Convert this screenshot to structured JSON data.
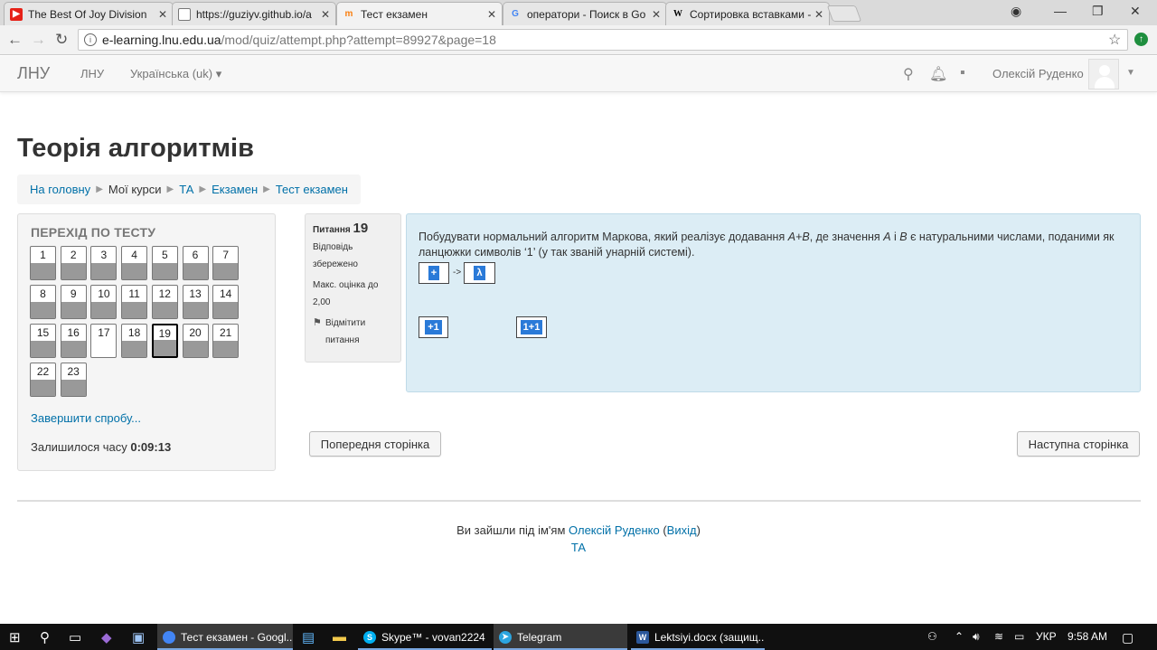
{
  "browser": {
    "tabs": [
      {
        "title": "The Best Of Joy Division",
        "icon": "youtube-icon",
        "color": "#e62117"
      },
      {
        "title": "https://guziyv.github.io/a",
        "icon": "page-icon",
        "color": "#777777"
      },
      {
        "title": "Тест екзамен",
        "icon": "moodle-icon",
        "color": "#f98012"
      },
      {
        "title": "оператори - Поиск в Go",
        "icon": "google-icon",
        "color": "#4285f4"
      },
      {
        "title": "Сортировка вставками -",
        "icon": "wikipedia-icon",
        "color": "#000000"
      }
    ],
    "url_host": "e-learning.lnu.edu.ua",
    "url_path": "/mod/quiz/attempt.php?attempt=89927&page=18"
  },
  "navbar": {
    "brand": "ЛНУ",
    "link_lnu": "ЛНУ",
    "language": "Українська (uk)",
    "user_name": "Олексій Руденко"
  },
  "page": {
    "title": "Теорія алгоритмів",
    "breadcrumb": [
      "На головну",
      "Мої курси",
      "ТА",
      "Екзамен",
      "Тест екзамен"
    ]
  },
  "quiz_nav": {
    "title": "ПЕРЕХІД ПО ТЕСТУ",
    "questions": [
      {
        "n": "1",
        "answered": true
      },
      {
        "n": "2",
        "answered": true
      },
      {
        "n": "3",
        "answered": true
      },
      {
        "n": "4",
        "answered": true
      },
      {
        "n": "5",
        "answered": true
      },
      {
        "n": "6",
        "answered": true
      },
      {
        "n": "7",
        "answered": true
      },
      {
        "n": "8",
        "answered": true
      },
      {
        "n": "9",
        "answered": true
      },
      {
        "n": "10",
        "answered": true
      },
      {
        "n": "11",
        "answered": true
      },
      {
        "n": "12",
        "answered": true
      },
      {
        "n": "13",
        "answered": true
      },
      {
        "n": "14",
        "answered": true
      },
      {
        "n": "15",
        "answered": true
      },
      {
        "n": "16",
        "answered": true
      },
      {
        "n": "17",
        "answered": false
      },
      {
        "n": "18",
        "answered": true
      },
      {
        "n": "19",
        "answered": true,
        "current": true
      },
      {
        "n": "20",
        "answered": true
      },
      {
        "n": "21",
        "answered": true
      },
      {
        "n": "22",
        "answered": true
      },
      {
        "n": "23",
        "answered": true
      }
    ],
    "finish_link": "Завершити спробу...",
    "time_left_label": "Залишилося часу",
    "time_left": "0:09:13"
  },
  "question": {
    "label": "Питання",
    "number": "19",
    "state": "Відповідь збережено",
    "max_mark": "Макс. оцінка до 2,00",
    "flag_label": "Відмітити питання",
    "text_part1": "Побудувати нормальний алгоритм Маркова, який реалізує додавання ",
    "text_expr": "A+B",
    "text_part2": ", де значення ",
    "text_a": "A",
    "text_and": " і ",
    "text_b": "B",
    "text_part3": " є натуральними числами, поданими як ланцюжки символів ‘1’ (у так званій унарній системі).",
    "rule_left": "+",
    "rule_arrow": "->",
    "rule_right": "λ",
    "drag_items": [
      "+1",
      "1+1"
    ]
  },
  "buttons": {
    "prev": "Попередня сторінка",
    "next": "Наступна сторінка"
  },
  "footer": {
    "logged_in_as": "Ви зайшли під ім'ям",
    "user": "Олексій Руденко",
    "logout": "Вихід",
    "course": "ТА"
  },
  "taskbar": {
    "apps": [
      {
        "label": "Тест екзамен - Googl...",
        "icon": "chrome-icon",
        "color": "#4285f4",
        "active": true
      },
      {
        "label": "Skype™ - vovan2224",
        "icon": "skype-icon",
        "color": "#00aff0",
        "active": false
      },
      {
        "label": "Telegram",
        "icon": "telegram-icon",
        "color": "#2ca5e0",
        "active": true
      },
      {
        "label": "Lektsiyi.docx (защищ...",
        "icon": "word-icon",
        "color": "#2b579a",
        "active": false
      }
    ],
    "language": "УКР",
    "time": "9:58 AM"
  }
}
